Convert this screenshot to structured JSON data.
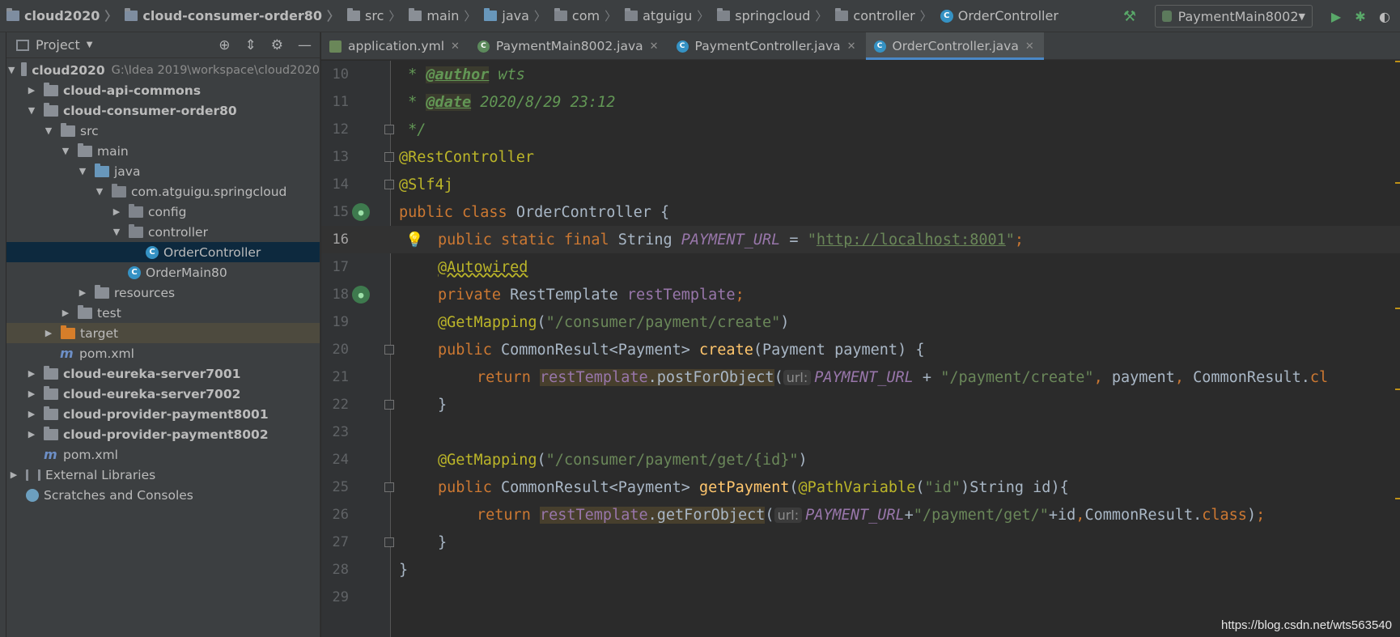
{
  "breadcrumb": {
    "items": [
      {
        "label": "cloud2020",
        "icon": "module-folder-icon"
      },
      {
        "label": "cloud-consumer-order80",
        "icon": "module-folder-icon"
      },
      {
        "label": "src",
        "icon": "folder-icon"
      },
      {
        "label": "main",
        "icon": "folder-icon"
      },
      {
        "label": "java",
        "icon": "source-folder-icon"
      },
      {
        "label": "com",
        "icon": "package-icon"
      },
      {
        "label": "atguigu",
        "icon": "package-icon"
      },
      {
        "label": "springcloud",
        "icon": "package-icon"
      },
      {
        "label": "controller",
        "icon": "package-icon"
      },
      {
        "label": "OrderController",
        "icon": "class-icon"
      }
    ]
  },
  "toolbar": {
    "run_config": "PaymentMain8002"
  },
  "project": {
    "title": "Project",
    "root_label": "cloud2020",
    "root_path": "G:\\Idea 2019\\workspace\\cloud2020",
    "tree": [
      {
        "label": "cloud-api-commons"
      },
      {
        "label": "cloud-consumer-order80"
      },
      {
        "label": "src"
      },
      {
        "label": "main"
      },
      {
        "label": "java"
      },
      {
        "label": "com.atguigu.springcloud"
      },
      {
        "label": "config"
      },
      {
        "label": "controller"
      },
      {
        "label": "OrderController"
      },
      {
        "label": "OrderMain80"
      },
      {
        "label": "resources"
      },
      {
        "label": "test"
      },
      {
        "label": "target"
      },
      {
        "label": "pom.xml"
      },
      {
        "label": "cloud-eureka-server7001"
      },
      {
        "label": "cloud-eureka-server7002"
      },
      {
        "label": "cloud-provider-payment8001"
      },
      {
        "label": "cloud-provider-payment8002"
      },
      {
        "label": "pom.xml"
      },
      {
        "label": "External Libraries"
      },
      {
        "label": "Scratches and Consoles"
      }
    ]
  },
  "tabs": [
    {
      "label": "application.yml"
    },
    {
      "label": "PaymentMain8002.java"
    },
    {
      "label": "PaymentController.java"
    },
    {
      "label": "OrderController.java"
    }
  ],
  "editor": {
    "line_numbers": [
      "10",
      "11",
      "12",
      "13",
      "14",
      "15",
      "16",
      "17",
      "18",
      "19",
      "20",
      "21",
      "22",
      "23",
      "24",
      "25",
      "26",
      "27",
      "28",
      "29"
    ],
    "current_line": "16",
    "hint_label": "url:",
    "tokens": {
      "author_tag": "@author",
      "author_val": " wts",
      "date_tag": "@date",
      "date_val": " 2020/8/29 23:12",
      "rest_controller": "@RestController",
      "slf4j": "@Slf4j",
      "public": "public",
      "class": "class",
      "class_name": "OrderController",
      "static": "static",
      "final": "final",
      "string_type": "String",
      "payment_url": "PAYMENT_URL",
      "url_value": "http://localhost:8001",
      "autowired": "@Autowired",
      "private": "private",
      "rest_template_type": "RestTemplate",
      "rest_template": "restTemplate",
      "get_mapping": "@GetMapping",
      "path_create": "\"/consumer/payment/create\"",
      "common_result_payment": "CommonResult<Payment>",
      "create": "create",
      "payment_type": "Payment",
      "payment": "payment",
      "return": "return",
      "post_for_object": "postForObject",
      "payment_create": "\"/payment/create\"",
      "common_result": "CommonResult",
      "class_kw": "class",
      "path_get": "\"/consumer/payment/get/{id}\"",
      "get_payment": "getPayment",
      "path_variable": "@PathVariable",
      "id_str": "\"id\"",
      "id": "id",
      "get_for_object": "getForObject",
      "payment_get": "\"/payment/get/\""
    }
  },
  "watermark": "https://blog.csdn.net/wts563540",
  "colors": {
    "keyword": "#cc7832",
    "annotation": "#bbb529",
    "string": "#6a8759",
    "field": "#9876aa",
    "method": "#ffc66d",
    "accent": "#4a88c7"
  }
}
